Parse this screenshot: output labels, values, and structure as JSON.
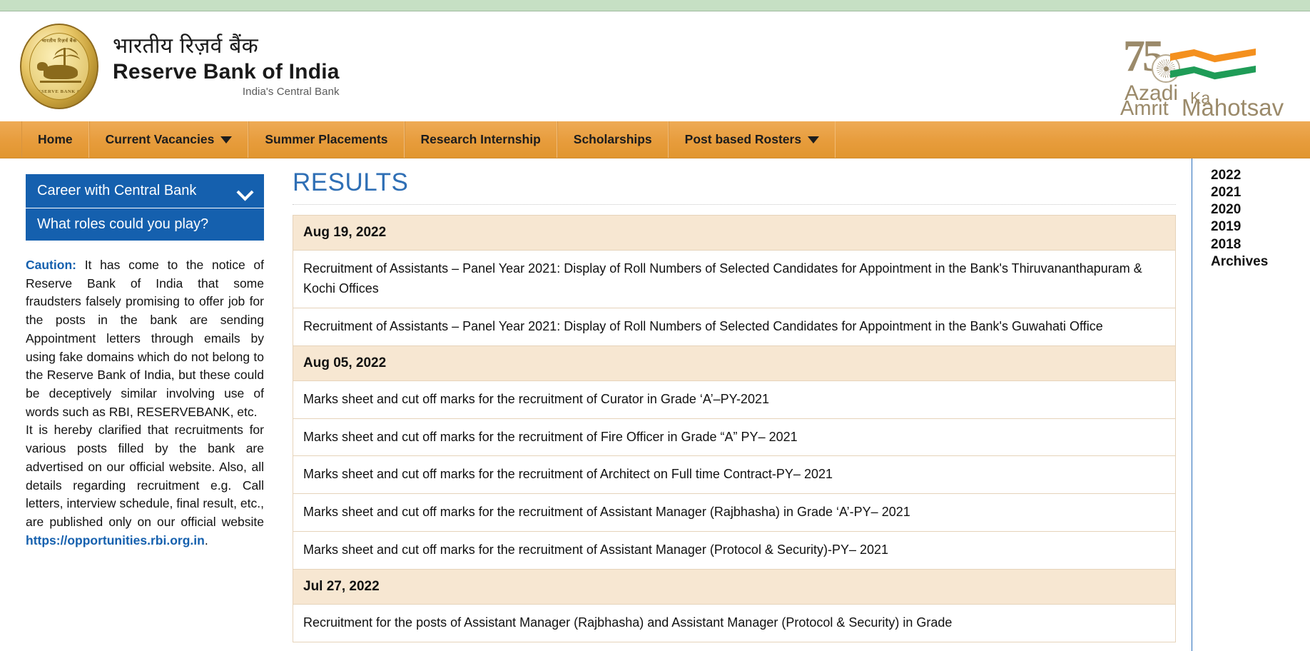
{
  "header": {
    "brand_hindi": "भारतीय रिज़र्व बैंक",
    "brand_english": "Reserve Bank of India",
    "brand_tagline": "India's Central Bank",
    "seal_text_top": "भारतीय रिज़र्व बैंक",
    "seal_text_bottom": "RESERVE BANK OF",
    "azadi": {
      "numeral": "75",
      "line1": "Azadi",
      "line2": "Ka",
      "line3": "Amrit",
      "line4": "Mahotsav"
    }
  },
  "nav": {
    "items": [
      {
        "label": "Home",
        "has_dropdown": false
      },
      {
        "label": "Current Vacancies",
        "has_dropdown": true
      },
      {
        "label": "Summer Placements",
        "has_dropdown": false
      },
      {
        "label": "Research Internship",
        "has_dropdown": false
      },
      {
        "label": "Scholarships",
        "has_dropdown": false
      },
      {
        "label": "Post based Rosters",
        "has_dropdown": true
      }
    ]
  },
  "sidebar": {
    "menu_head": "Career with Central Bank",
    "menu_item": "What roles could you play?",
    "caution": {
      "label": "Caution:",
      "para1": " It has come to the notice of Reserve Bank of India that some fraudsters falsely promising to offer job for the posts in the bank are sending Appointment letters through emails by using fake domains which do not belong to the Reserve Bank of India, but these could be deceptively similar involving use of words such as RBI, RESERVEBANK, etc.",
      "para2_before": "It is hereby clarified that recruitments for various posts filled by the bank are advertised on our official website. Also, all details regarding recruitment e.g. Call letters, interview schedule, final result, etc., are published only on our official website ",
      "link": "https://opportunities.rbi.org.in",
      "para2_after": "."
    }
  },
  "main": {
    "title": "RESULTS",
    "sections": [
      {
        "date": "Aug 19, 2022",
        "entries": [
          "Recruitment of Assistants – Panel Year 2021: Display of Roll Numbers of Selected Candidates for Appointment in the Bank's Thiruvananthapuram & Kochi Offices",
          "Recruitment of Assistants – Panel Year 2021: Display of Roll Numbers of Selected Candidates for Appointment in the Bank's Guwahati Office"
        ]
      },
      {
        "date": "Aug 05, 2022",
        "entries": [
          "Marks sheet and cut off marks for the recruitment of Curator in Grade ‘A’–PY-2021",
          "Marks sheet and cut off marks for the recruitment of Fire Officer in Grade “A” PY– 2021",
          "Marks sheet and cut off marks for the recruitment of Architect on Full time Contract-PY– 2021",
          "Marks sheet and cut off marks for the recruitment of Assistant Manager (Rajbhasha) in Grade ‘A’-PY– 2021",
          "Marks sheet and cut off marks for the recruitment of Assistant Manager (Protocol & Security)-PY– 2021"
        ]
      },
      {
        "date": "Jul 27, 2022",
        "entries": [
          "Recruitment for the posts of Assistant Manager (Rajbhasha) and Assistant Manager (Protocol & Security) in Grade"
        ]
      }
    ]
  },
  "year_rail": {
    "items": [
      "2022",
      "2021",
      "2020",
      "2019",
      "2018",
      "Archives"
    ]
  },
  "colors": {
    "nav_orange": "#e79c3c",
    "sidebar_blue": "#1560ae",
    "title_blue": "#2f6fb5",
    "date_band": "#f7e7d2",
    "top_strip_green": "#c6e0c4"
  }
}
